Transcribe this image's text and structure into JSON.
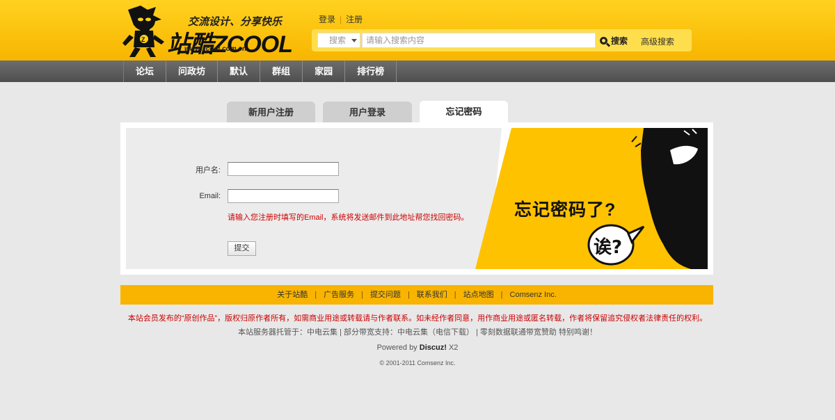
{
  "header": {
    "slogan": "交流设计、分享快乐",
    "brand": "站酷ZCOOL",
    "url": "www.zcool.com.cn",
    "login": "登录",
    "register": "注册"
  },
  "search": {
    "category": "搜索",
    "placeholder": "请输入搜索内容",
    "button": "搜索",
    "advanced": "高级搜索"
  },
  "nav": [
    "论坛",
    "问政坊",
    "默认",
    "群组",
    "家园",
    "排行榜"
  ],
  "tabs": {
    "register": "新用户注册",
    "login": "用户登录",
    "forgot": "忘记密码"
  },
  "form": {
    "username_label": "用户名:",
    "email_label": "Email:",
    "hint": "请输入您注册时填写的Email，系统将发送邮件到此地址帮您找回密码。",
    "submit": "提交"
  },
  "promo": {
    "headline": "忘记密码了?",
    "bubble": "诶?"
  },
  "footer": {
    "links": [
      "关于站酷",
      "广告服务",
      "提交问题",
      "联系我们",
      "站点地图",
      "Comsenz Inc."
    ],
    "notice": "本站会员发布的“原创作品”，版权归原作者所有，如需商业用途或转载请与作者联系。如未经作者同意，用作商业用途或匿名转载，作者将保留追究侵权者法律责任的权利。",
    "hosting": "本站服务器托管于：中电云集 | 部分带宽支持：中电云集（电信下载） | 零刻数据联通带宽赞助 特别鸣谢！",
    "powered_prefix": "Powered by",
    "powered_name": "Discuz!",
    "powered_version": "X2",
    "copyright": "© 2001-2011 Comsenz Inc."
  },
  "colors": {
    "brand_yellow": "#ffc800",
    "nav_gray": "#5e5e5e",
    "hint_red": "#cc0000"
  }
}
